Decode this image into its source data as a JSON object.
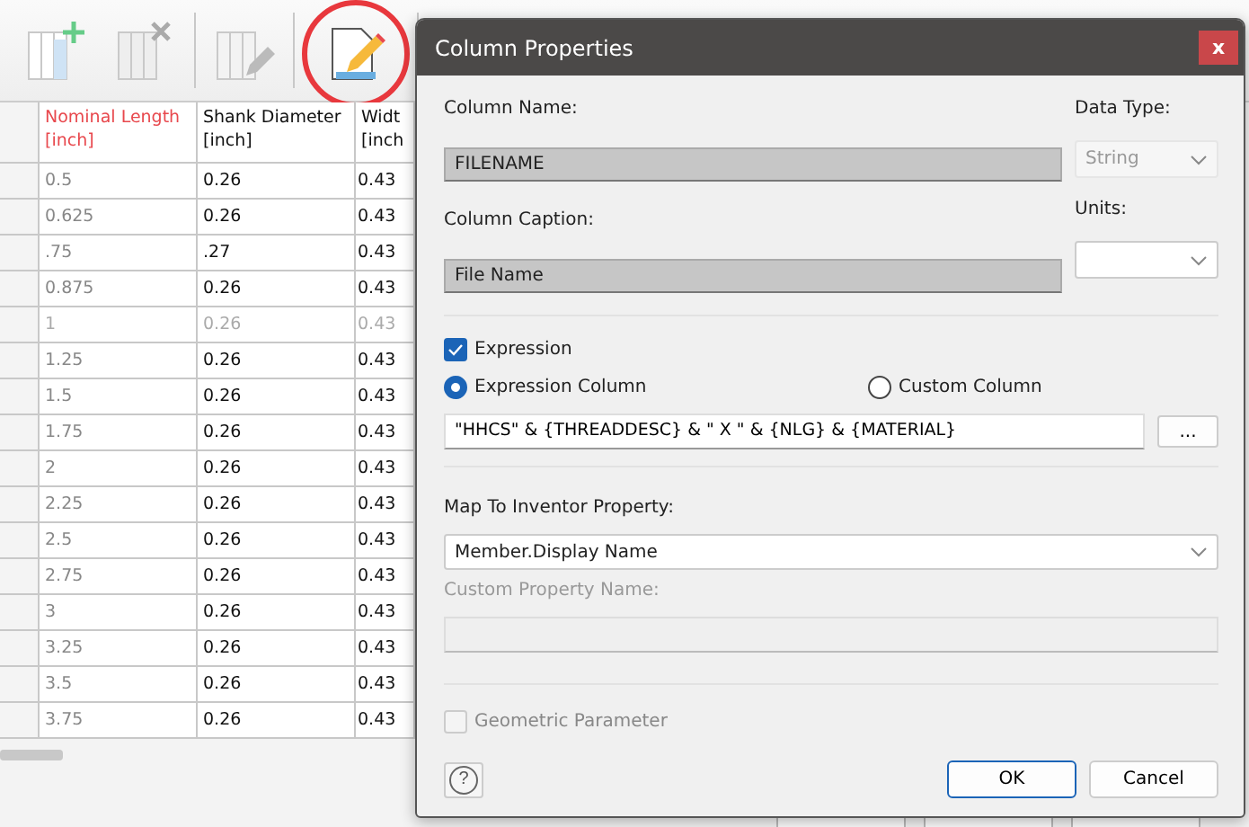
{
  "toolbar": {
    "tools": [
      {
        "kind": "add-column",
        "selected": false
      },
      {
        "kind": "delete-column",
        "selected": false
      },
      {
        "kind": "edit-column",
        "selected": false
      },
      {
        "kind": "column-properties",
        "selected": true
      }
    ]
  },
  "table": {
    "columns": [
      {
        "label": "Nominal Length",
        "unit": "[inch]",
        "highlighted": true
      },
      {
        "label": "Shank Diameter",
        "unit": "[inch]",
        "highlighted": false
      },
      {
        "label": "Widt",
        "unit": "[inch",
        "highlighted": false
      }
    ],
    "rows": [
      {
        "cells": [
          "0.5",
          "0.26",
          "0.43"
        ],
        "dimmed": false
      },
      {
        "cells": [
          "0.625",
          "0.26",
          "0.43"
        ],
        "dimmed": false
      },
      {
        "cells": [
          ".75",
          ".27",
          "0.43"
        ],
        "dimmed": false
      },
      {
        "cells": [
          "0.875",
          "0.26",
          "0.43"
        ],
        "dimmed": false
      },
      {
        "cells": [
          "1",
          "0.26",
          "0.43"
        ],
        "dimmed": true
      },
      {
        "cells": [
          "1.25",
          "0.26",
          "0.43"
        ],
        "dimmed": false
      },
      {
        "cells": [
          "1.5",
          "0.26",
          "0.43"
        ],
        "dimmed": false
      },
      {
        "cells": [
          "1.75",
          "0.26",
          "0.43"
        ],
        "dimmed": false
      },
      {
        "cells": [
          "2",
          "0.26",
          "0.43"
        ],
        "dimmed": false
      },
      {
        "cells": [
          "2.25",
          "0.26",
          "0.43"
        ],
        "dimmed": false
      },
      {
        "cells": [
          "2.5",
          "0.26",
          "0.43"
        ],
        "dimmed": false
      },
      {
        "cells": [
          "2.75",
          "0.26",
          "0.43"
        ],
        "dimmed": false
      },
      {
        "cells": [
          "3",
          "0.26",
          "0.43"
        ],
        "dimmed": false
      },
      {
        "cells": [
          "3.25",
          "0.26",
          "0.43"
        ],
        "dimmed": false
      },
      {
        "cells": [
          "3.5",
          "0.26",
          "0.43"
        ],
        "dimmed": false
      },
      {
        "cells": [
          "3.75",
          "0.26",
          "0.43"
        ],
        "dimmed": false
      }
    ]
  },
  "dialog": {
    "title": "Column Properties",
    "close": "x",
    "column_name": {
      "label": "Column Name:",
      "value": "FILENAME"
    },
    "data_type": {
      "label": "Data Type:",
      "value": "String",
      "disabled": true
    },
    "column_caption": {
      "label": "Column Caption:",
      "value": "File Name"
    },
    "units": {
      "label": "Units:",
      "disabled": false
    },
    "expression": {
      "label": "Expression",
      "checked": true
    },
    "column_types": [
      {
        "label": "Expression Column",
        "selected": true
      },
      {
        "label": "Custom Column",
        "selected": false
      }
    ],
    "expression_value": "\"HHCS\" & {THREADDESC} & \" X \" & {NLG} & {MATERIAL}",
    "browse": "...",
    "map_property": {
      "label": "Map To Inventor Property:",
      "value": "Member.Display Name"
    },
    "custom_property": {
      "label": "Custom Property Name:",
      "disabled": true
    },
    "geometric": {
      "label": "Geometric Parameter",
      "checked": false,
      "disabled": true
    },
    "help": "?",
    "buttons": [
      "OK",
      "Cancel"
    ]
  }
}
